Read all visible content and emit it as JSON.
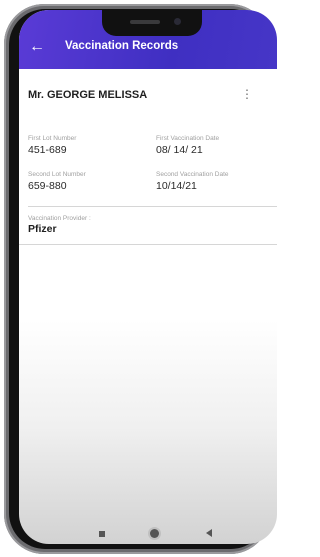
{
  "header": {
    "back_icon": "arrow-left-icon",
    "title": "Vaccination Records"
  },
  "patient": {
    "name": "Mr. GEORGE MELISSA",
    "menu_icon": "more-vertical-icon"
  },
  "fields": {
    "first_lot_label": "First Lot Number",
    "first_lot_value": "451-689",
    "first_date_label": "First Vaccination Date",
    "first_date_value": "08/ 14/ 21",
    "second_lot_label": "Second Lot Number",
    "second_lot_value": "659-880",
    "second_date_label": "Second Vaccination Date",
    "second_date_value": "10/14/21",
    "provider_label": "Vaccination Provider :",
    "provider_value": "Pfizer"
  },
  "navbar": {
    "recents_icon": "square-icon",
    "home_icon": "circle-icon",
    "back_icon": "triangle-back-icon"
  },
  "colors": {
    "appbar": "#4a33cc",
    "label": "#a0a0a0",
    "value": "#2a2a2a"
  }
}
